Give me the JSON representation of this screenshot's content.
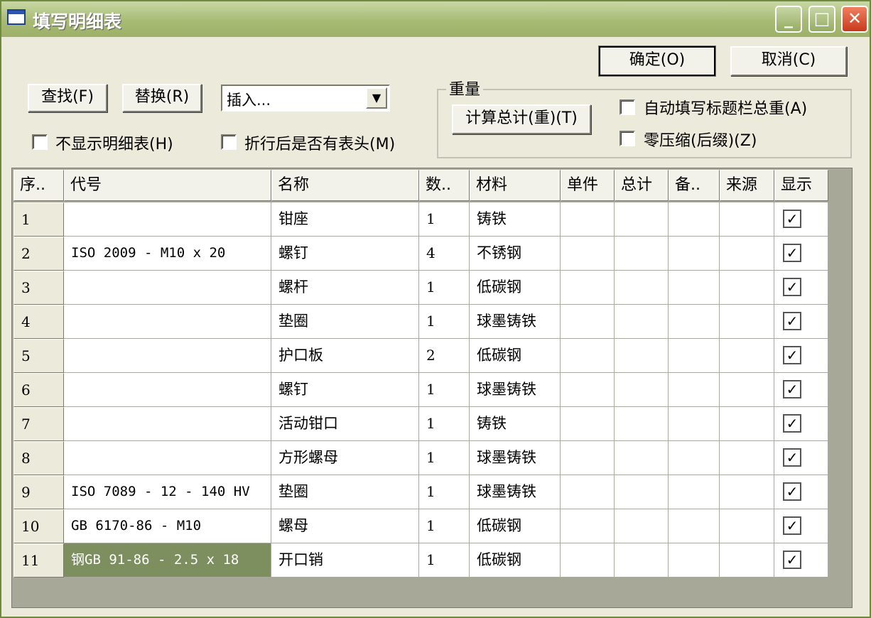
{
  "window": {
    "title": "填写明细表"
  },
  "titlebar": {
    "min": "_",
    "max": "□",
    "close": "✕"
  },
  "buttons": {
    "ok": "确定(O)",
    "cancel": "取消(C)",
    "find": "查找(F)",
    "replace": "替换(R)",
    "calc": "计算总计(重)(T)"
  },
  "combo": {
    "value": "插入..."
  },
  "options": {
    "hide_table": "不显示明细表(H)",
    "header_after_wrap": "折行后是否有表头(M)",
    "auto_fill_weight": "自动填写标题栏总重(A)",
    "zero_compress": "零压缩(后缀)(Z)"
  },
  "weight_group": {
    "title": "重量"
  },
  "table": {
    "columns": [
      "序..",
      "代号",
      "名称",
      "数..",
      "材料",
      "单件",
      "总计",
      "备..",
      "来源",
      "显示"
    ],
    "rows": [
      {
        "seq": "1",
        "code": "",
        "name": "钳座",
        "qty": "1",
        "material": "铸铁",
        "unit": "",
        "total": "",
        "note": "",
        "source": "",
        "show": "✓"
      },
      {
        "seq": "2",
        "code": "ISO 2009 - M10 x 20",
        "name": "螺钉",
        "qty": "4",
        "material": "不锈钢",
        "unit": "",
        "total": "",
        "note": "",
        "source": "",
        "show": "✓"
      },
      {
        "seq": "3",
        "code": "",
        "name": "螺杆",
        "qty": "1",
        "material": "低碳钢",
        "unit": "",
        "total": "",
        "note": "",
        "source": "",
        "show": "✓"
      },
      {
        "seq": "4",
        "code": "",
        "name": "垫圈",
        "qty": "1",
        "material": "球墨铸铁",
        "unit": "",
        "total": "",
        "note": "",
        "source": "",
        "show": "✓"
      },
      {
        "seq": "5",
        "code": "",
        "name": "护口板",
        "qty": "2",
        "material": "低碳钢",
        "unit": "",
        "total": "",
        "note": "",
        "source": "",
        "show": "✓"
      },
      {
        "seq": "6",
        "code": "",
        "name": "螺钉",
        "qty": "1",
        "material": "球墨铸铁",
        "unit": "",
        "total": "",
        "note": "",
        "source": "",
        "show": "✓"
      },
      {
        "seq": "7",
        "code": "",
        "name": "活动钳口",
        "qty": "1",
        "material": "铸铁",
        "unit": "",
        "total": "",
        "note": "",
        "source": "",
        "show": "✓"
      },
      {
        "seq": "8",
        "code": "",
        "name": "方形螺母",
        "qty": "1",
        "material": "球墨铸铁",
        "unit": "",
        "total": "",
        "note": "",
        "source": "",
        "show": "✓"
      },
      {
        "seq": "9",
        "code": "ISO 7089 - 12 - 140 HV",
        "name": "垫圈",
        "qty": "1",
        "material": "球墨铸铁",
        "unit": "",
        "total": "",
        "note": "",
        "source": "",
        "show": "✓"
      },
      {
        "seq": "10",
        "code": "GB 6170-86 - M10",
        "name": "螺母",
        "qty": "1",
        "material": "低碳钢",
        "unit": "",
        "total": "",
        "note": "",
        "source": "",
        "show": "✓"
      },
      {
        "seq": "11",
        "code": "钢GB 91-86 - 2.5 x 18",
        "name": "开口销",
        "qty": "1",
        "material": "低碳钢",
        "unit": "",
        "total": "",
        "note": "",
        "source": "",
        "show": "✓"
      }
    ]
  },
  "colors": {
    "titlebar": "#a7bb74",
    "selection": "#7d8f5f",
    "dialog": "#eceadb"
  }
}
